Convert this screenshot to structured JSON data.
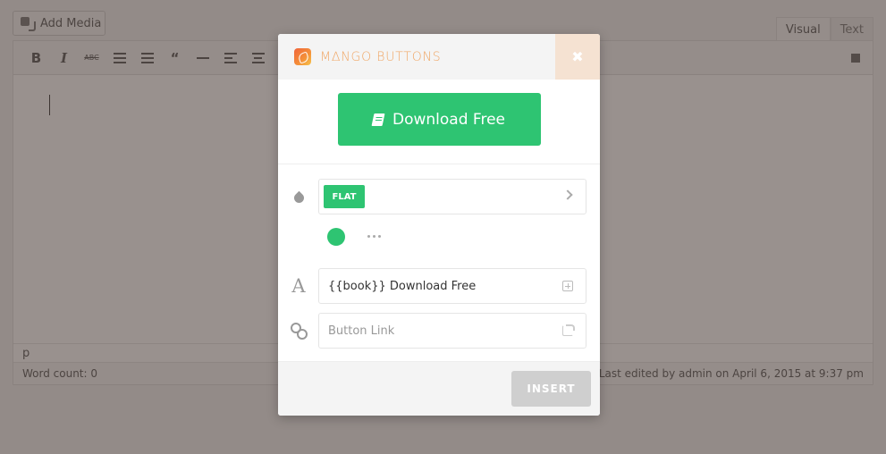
{
  "editor": {
    "add_media_label": "Add Media",
    "tabs": [
      {
        "label": "Visual"
      },
      {
        "label": "Text"
      }
    ],
    "toolbar": {
      "bold": "B",
      "italic": "I",
      "strikethrough": "ABC",
      "blockquote": "“"
    },
    "path": "p",
    "word_count": "Word count: 0",
    "last_edited": "Last edited by admin on April 6, 2015 at 9:37 pm"
  },
  "modal": {
    "brand": "M∆NGO BUTTONS",
    "close_glyph": "✖",
    "preview": {
      "label": "Download Free",
      "icon": "book-icon",
      "color": "#2ec472"
    },
    "style": {
      "selected": "FLAT",
      "color": "#2ec472"
    },
    "text_field": {
      "value": "{{book}} Download Free"
    },
    "link_field": {
      "value": "",
      "placeholder": "Button Link"
    },
    "insert_label": "INSERT"
  }
}
